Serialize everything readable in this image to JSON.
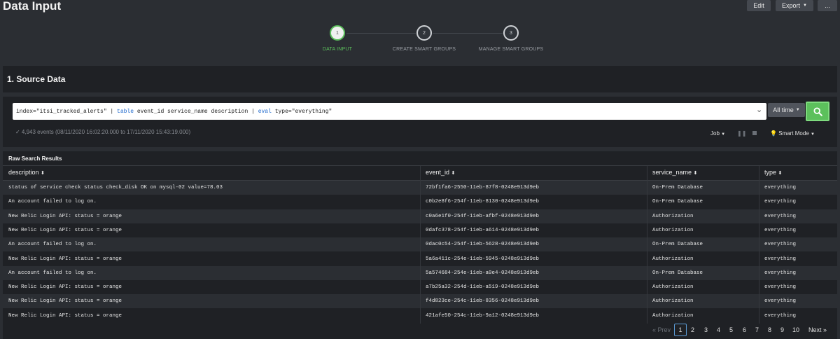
{
  "header": {
    "title": "Data Input",
    "edit_label": "Edit",
    "export_label": "Export",
    "more_label": "..."
  },
  "steps": [
    {
      "number": "1",
      "label": "DATA INPUT",
      "active": true
    },
    {
      "number": "2",
      "label": "CREATE SMART GROUPS",
      "active": false
    },
    {
      "number": "3",
      "label": "MANAGE SMART GROUPS",
      "active": false
    }
  ],
  "source": {
    "section_title": "1. Source Data",
    "query_parts": [
      "index=\"itsi_tracked_alerts\" | ",
      "table",
      " event_id service_name description | ",
      "eval",
      " type=\"everything\""
    ],
    "time_picker_label": "All time",
    "status": "✓ 4,943 events (08/11/2020 16:02:20.000 to 17/11/2020 15:43:19.000)",
    "job_label": "Job",
    "smart_mode_label": "Smart Mode"
  },
  "results": {
    "title": "Raw Search Results",
    "columns": [
      "description",
      "event_id",
      "service_name",
      "type"
    ],
    "rows": [
      [
        "status of service check status check_disk OK on mysql-02  value=78.03",
        "72bf1fa6-2550-11eb-87f8-0248e913d9eb",
        "On-Prem Database",
        "everything"
      ],
      [
        "An account failed to log on.",
        "c0b2e8f6-254f-11eb-8130-0248e913d9eb",
        "On-Prem Database",
        "everything"
      ],
      [
        "New Relic Login API: status = orange",
        "c0a6e1f0-254f-11eb-afbf-0248e913d9eb",
        "Authorization",
        "everything"
      ],
      [
        "New Relic Login API: status = orange",
        "0dafc378-254f-11eb-a614-0248e913d9eb",
        "Authorization",
        "everything"
      ],
      [
        "An account failed to log on.",
        "0dac0c54-254f-11eb-5628-0248e913d9eb",
        "On-Prem Database",
        "everything"
      ],
      [
        "New Relic Login API: status = orange",
        "5a6a411c-254e-11eb-5945-0248e913d9eb",
        "Authorization",
        "everything"
      ],
      [
        "An account failed to log on.",
        "5a574684-254e-11eb-a0e4-0248e913d9eb",
        "On-Prem Database",
        "everything"
      ],
      [
        "New Relic Login API: status = orange",
        "a7b25a32-254d-11eb-a519-0248e913d9eb",
        "Authorization",
        "everything"
      ],
      [
        "New Relic Login API: status = orange",
        "f4d823ce-254c-11eb-8356-0248e913d9eb",
        "Authorization",
        "everything"
      ],
      [
        "New Relic Login API: status = orange",
        "421afe50-254c-11eb-9a12-0248e913d9eb",
        "Authorization",
        "everything"
      ]
    ]
  },
  "pagination": {
    "prev_label": "« Prev",
    "pages": [
      "1",
      "2",
      "3",
      "4",
      "5",
      "6",
      "7",
      "8",
      "9",
      "10"
    ],
    "current": "1",
    "next_label": "Next »"
  },
  "colors": {
    "accent_green": "#5cc05c",
    "background": "#2b2e33",
    "panel": "#1f2125"
  }
}
